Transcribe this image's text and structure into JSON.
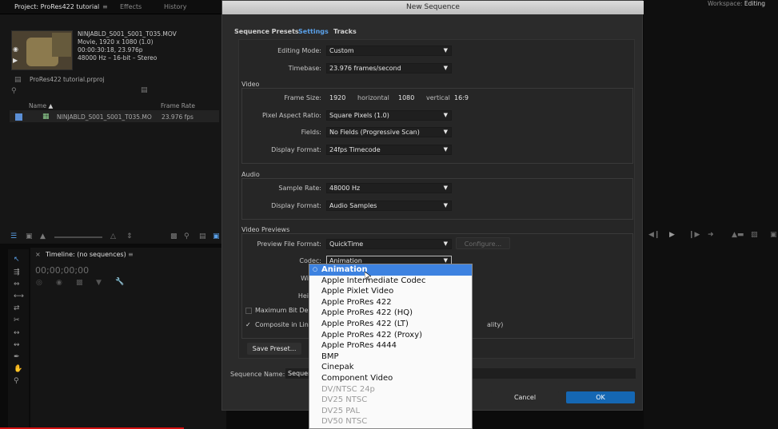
{
  "workspace": {
    "label": "Workspace:",
    "value": "Editing"
  },
  "project_panel": {
    "tabs": [
      "Project: ProRes422 tutorial",
      "Effects",
      "History"
    ],
    "clip": {
      "name": "NINJABLD_S001_S001_T035.MOV",
      "info1": "Movie, 1920 x 1080 (1.0)",
      "info2": "00:00:30:18, 23.976p",
      "info3": "48000 Hz – 16-bit – Stereo"
    },
    "project_file": "ProRes422 tutorial.prproj",
    "columns": {
      "name": "Name",
      "frame_rate": "Frame Rate"
    },
    "row": {
      "name": "NINJABLD_S001_S001_T035.MO",
      "frame_rate": "23.976 fps"
    }
  },
  "timeline_panel": {
    "title": "Timeline: (no sequences)",
    "timecode": "00;00;00;00"
  },
  "dialog": {
    "title": "New Sequence",
    "tabs": [
      "Sequence Presets",
      "Settings",
      "Tracks"
    ],
    "active_tab": "Settings",
    "editing_mode": {
      "label": "Editing Mode:",
      "value": "Custom"
    },
    "timebase": {
      "label": "Timebase:",
      "value": "23.976 frames/second"
    },
    "video": {
      "section": "Video",
      "frame_size_label": "Frame Size:",
      "width": "1920",
      "horizontal": "horizontal",
      "height": "1080",
      "vertical": "vertical",
      "aspect": "16:9",
      "par": {
        "label": "Pixel Aspect Ratio:",
        "value": "Square Pixels (1.0)"
      },
      "fields": {
        "label": "Fields:",
        "value": "No Fields (Progressive Scan)"
      },
      "display_format": {
        "label": "Display Format:",
        "value": "24fps Timecode"
      }
    },
    "audio": {
      "section": "Audio",
      "sample_rate": {
        "label": "Sample Rate:",
        "value": "48000 Hz"
      },
      "display_format": {
        "label": "Display Format:",
        "value": "Audio Samples"
      }
    },
    "previews": {
      "section": "Video Previews",
      "file_format": {
        "label": "Preview File Format:",
        "value": "QuickTime"
      },
      "configure": "Configure...",
      "codec": {
        "label": "Codec:",
        "value": "Animation"
      },
      "width_label": "Width:",
      "height_label": "Height:"
    },
    "max_bit_depth": "Maximum Bit Depth",
    "composite_linear": "Composite in Line",
    "quality_tail": "ality)",
    "save_preset": "Save Preset...",
    "sequence_name": {
      "label": "Sequence Name:",
      "value": "Sequen"
    },
    "cancel": "Cancel",
    "ok": "OK"
  },
  "codec_options": [
    {
      "label": "Animation",
      "state": "selected"
    },
    {
      "label": "Apple Intermediate Codec",
      "state": "enabled"
    },
    {
      "label": "Apple Pixlet Video",
      "state": "enabled"
    },
    {
      "label": "Apple ProRes 422",
      "state": "enabled"
    },
    {
      "label": "Apple ProRes 422 (HQ)",
      "state": "enabled"
    },
    {
      "label": "Apple ProRes 422 (LT)",
      "state": "enabled"
    },
    {
      "label": "Apple ProRes 422 (Proxy)",
      "state": "enabled"
    },
    {
      "label": "Apple ProRes 4444",
      "state": "enabled"
    },
    {
      "label": "BMP",
      "state": "enabled"
    },
    {
      "label": "Cinepak",
      "state": "enabled"
    },
    {
      "label": "Component Video",
      "state": "enabled"
    },
    {
      "label": "DV/NTSC 24p",
      "state": "disabled"
    },
    {
      "label": "DV25 NTSC",
      "state": "disabled"
    },
    {
      "label": "DV25 PAL",
      "state": "disabled"
    },
    {
      "label": "DV50 NTSC",
      "state": "disabled"
    }
  ],
  "colors": {
    "accent": "#3d82e0",
    "ok_button": "#1567b3",
    "active_tab": "#5aa0e8"
  }
}
